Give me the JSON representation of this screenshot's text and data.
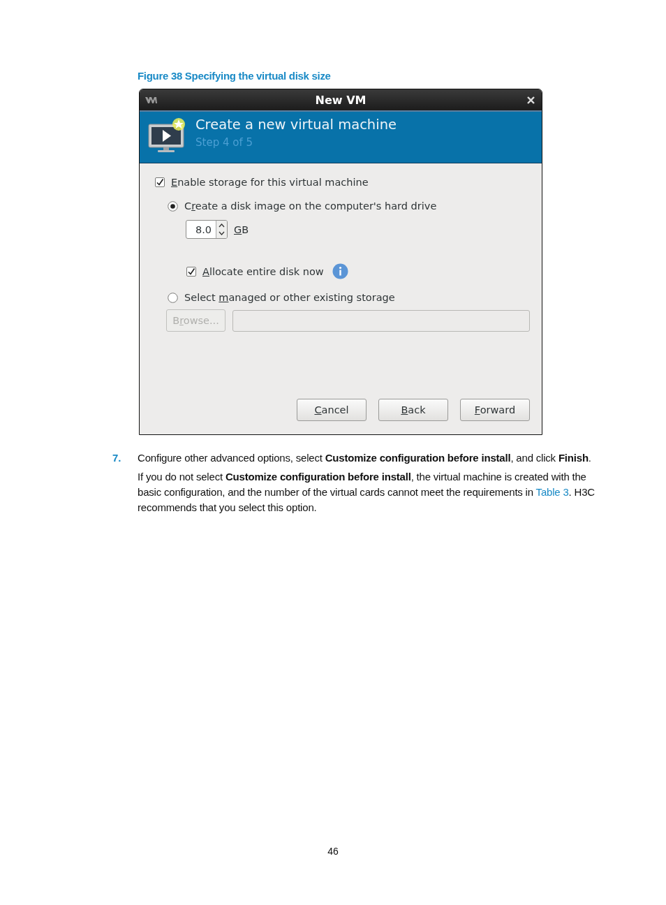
{
  "figure_caption": "Figure 38 Specifying the virtual disk size",
  "dialog": {
    "title": "New VM",
    "header": {
      "title": "Create a new virtual machine",
      "step": "Step 4 of 5"
    },
    "enable_storage": {
      "label": {
        "key": "E",
        "rest": "nable storage for this virtual machine"
      },
      "checked": true
    },
    "storage_options": [
      {
        "kind": "create",
        "label": {
          "lead": "C",
          "key": "r",
          "rest": "eate a disk image on the computer's hard drive"
        },
        "selected": true
      },
      {
        "kind": "existing",
        "label": {
          "lead": "Select ",
          "key": "m",
          "rest": "anaged or other existing storage"
        },
        "selected": false
      }
    ],
    "disk_size": {
      "value": "8.0",
      "unit": {
        "key": "G",
        "rest": "B"
      }
    },
    "allocate": {
      "label": {
        "key": "A",
        "rest": "llocate entire disk now"
      },
      "checked": true
    },
    "browse_button": {
      "label": {
        "lead": "B",
        "key": "r",
        "rest": "owse..."
      },
      "disabled": true
    },
    "path_field": {
      "disabled": true
    },
    "buttons": [
      {
        "label": {
          "key": "C",
          "rest": "ancel"
        }
      },
      {
        "label": {
          "key": "B",
          "rest": "ack"
        }
      },
      {
        "label": {
          "key": "F",
          "rest": "orward"
        }
      }
    ]
  },
  "step": {
    "number": "7.",
    "text": "Configure other advanced options, select **Customize configuration before install**, and click **Finish**."
  },
  "note": {
    "before": "If you do not select **Customize configuration before install**, the virtual machine is created with the basic configuration, and the number of the virtual cards cannot meet the requirements in ",
    "link": "Table 3",
    "after": ". H3C recommends that you select this option."
  },
  "page_number": "46"
}
